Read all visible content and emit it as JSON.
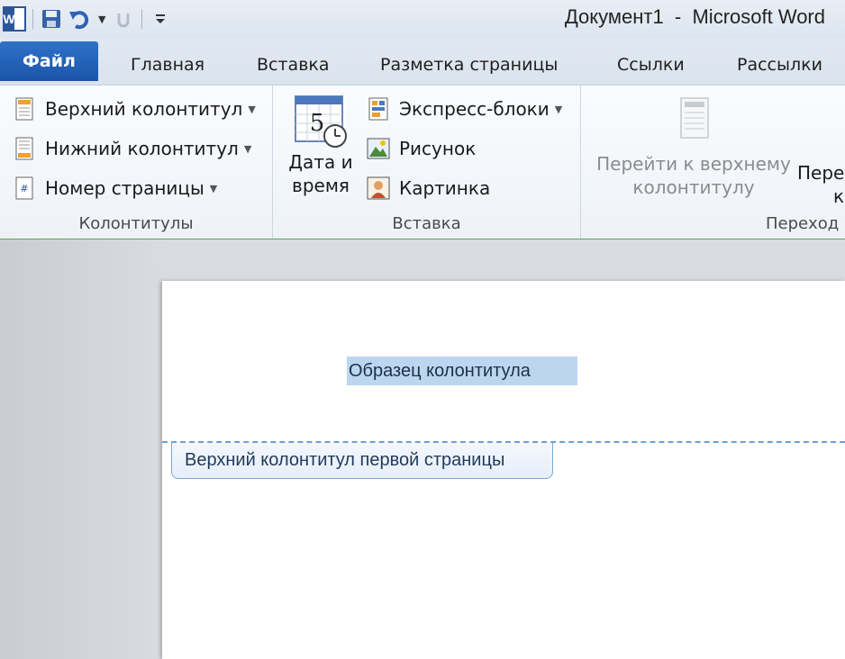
{
  "window": {
    "title": "Документ1  -  Microsoft Word"
  },
  "quick_access": {
    "app_icon": "word-icon",
    "save_icon": "save-icon",
    "undo_icon": "undo-icon",
    "redo_icon": "redo-icon",
    "customize_icon": "customize-icon"
  },
  "tabs": {
    "file": "Файл",
    "home": "Главная",
    "insert": "Вставка",
    "layout": "Разметка страницы",
    "references": "Ссылки",
    "mailings": "Рассылки"
  },
  "ribbon": {
    "header_footer_group": {
      "label": "Колонтитулы",
      "header": "Верхний колонтитул",
      "footer": "Нижний колонтитул",
      "page_number": "Номер страницы"
    },
    "insert_group": {
      "label": "Вставка",
      "date_line1": "Дата и",
      "date_line2": "время",
      "quick_parts": "Экспресс-блоки",
      "picture": "Рисунок",
      "clipart": "Картинка"
    },
    "navigation_group": {
      "label": "Переход",
      "go_header_line1": "Перейти к верхнему",
      "go_header_line2": "колонтитулу",
      "go_footer_line1": "Пере",
      "go_footer_line2": "к"
    }
  },
  "document": {
    "header_text": "Образец колонтитула",
    "header_tag": "Верхний колонтитул первой страницы"
  },
  "colors": {
    "file_tab": "#2467c0",
    "selection": "#bcd6f0",
    "header_line": "#6d9fd8",
    "ribbon_border": "#5ba65b"
  }
}
